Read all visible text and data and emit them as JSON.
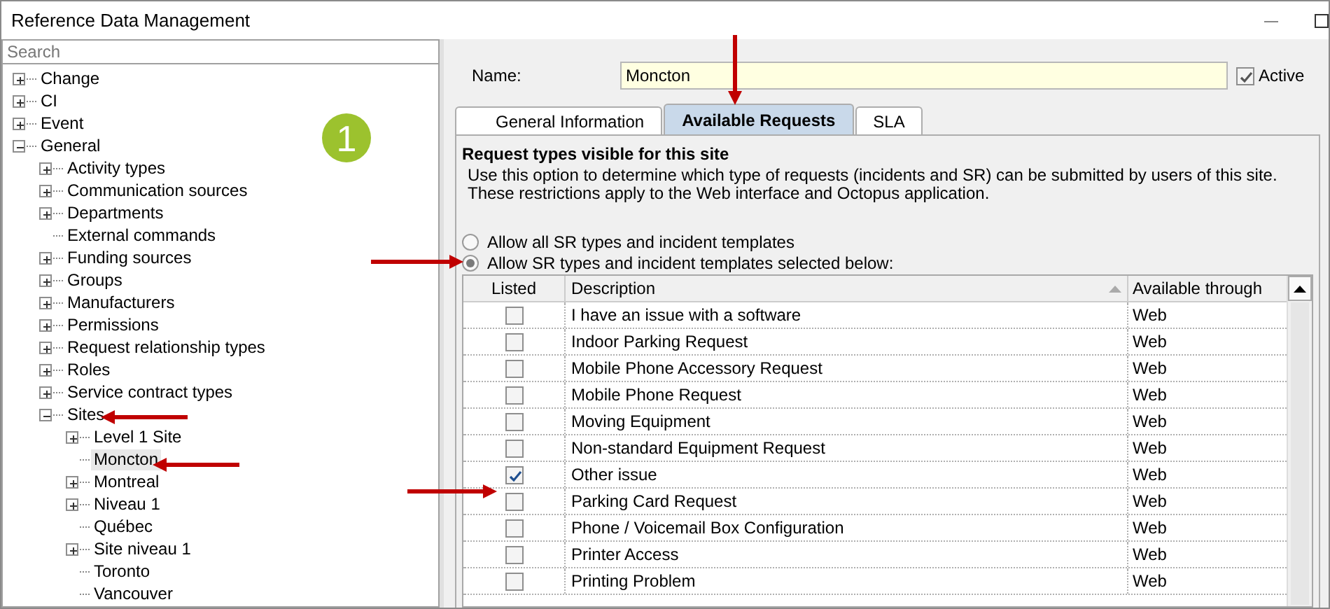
{
  "window": {
    "title": "Reference Data Management"
  },
  "search": {
    "placeholder": "Search"
  },
  "tree": [
    {
      "label": "Change",
      "expanded": false,
      "selected": false
    },
    {
      "label": "CI",
      "expanded": false,
      "selected": false
    },
    {
      "label": "Event",
      "expanded": false,
      "selected": false
    },
    {
      "label": "General",
      "expanded": true,
      "selected": false,
      "children": [
        {
          "label": "Activity types",
          "expanded": false,
          "selected": false
        },
        {
          "label": "Communication sources",
          "expanded": false,
          "selected": false
        },
        {
          "label": "Departments",
          "expanded": false,
          "selected": false
        },
        {
          "label": "External commands",
          "selected": false
        },
        {
          "label": "Funding sources",
          "expanded": false,
          "selected": false
        },
        {
          "label": "Groups",
          "expanded": false,
          "selected": false
        },
        {
          "label": "Manufacturers",
          "expanded": false,
          "selected": false
        },
        {
          "label": "Permissions",
          "expanded": false,
          "selected": false
        },
        {
          "label": "Request relationship types",
          "expanded": false,
          "selected": false
        },
        {
          "label": "Roles",
          "expanded": false,
          "selected": false
        },
        {
          "label": "Service contract types",
          "expanded": false,
          "selected": false
        },
        {
          "label": "Sites",
          "expanded": true,
          "selected": false,
          "children": [
            {
              "label": "Level 1 Site",
              "expanded": false,
              "selected": false
            },
            {
              "label": "Moncton",
              "selected": true
            },
            {
              "label": "Montreal",
              "expanded": false,
              "selected": false
            },
            {
              "label": "Niveau 1",
              "expanded": false,
              "selected": false
            },
            {
              "label": "Québec",
              "selected": false
            },
            {
              "label": "Site niveau 1",
              "expanded": false,
              "selected": false
            },
            {
              "label": "Toronto",
              "selected": false
            },
            {
              "label": "Vancouver",
              "selected": false
            }
          ]
        }
      ]
    }
  ],
  "callout": {
    "number": "1"
  },
  "name_field": {
    "label": "Name:",
    "value": "Moncton"
  },
  "active": {
    "label": "Active",
    "checked": true
  },
  "tabs": [
    {
      "label": "General Information",
      "selected": false
    },
    {
      "label": "Available Requests",
      "selected": true
    },
    {
      "label": "SLA",
      "selected": false
    }
  ],
  "section": {
    "title": "Request types visible for this site",
    "description": [
      "Use this option to determine which type of requests (incidents and SR) can be submitted by users of this site.",
      "These restrictions apply to the Web interface and Octopus application."
    ]
  },
  "options": [
    {
      "label": "Allow all SR types and incident templates",
      "selected": false
    },
    {
      "label": "Allow SR types and incident templates selected below:",
      "selected": true
    }
  ],
  "table": {
    "columns": [
      "Listed",
      "Description",
      "Available through"
    ],
    "rows": [
      {
        "listed": false,
        "description": "I have an issue with a software",
        "available": "Web"
      },
      {
        "listed": false,
        "description": "Indoor Parking Request",
        "available": "Web"
      },
      {
        "listed": false,
        "description": "Mobile Phone Accessory Request",
        "available": "Web"
      },
      {
        "listed": false,
        "description": "Mobile Phone Request",
        "available": "Web"
      },
      {
        "listed": false,
        "description": "Moving Equipment",
        "available": "Web"
      },
      {
        "listed": false,
        "description": "Non-standard Equipment Request",
        "available": "Web"
      },
      {
        "listed": true,
        "description": "Other issue",
        "available": "Web"
      },
      {
        "listed": false,
        "description": "Parking Card Request",
        "available": "Web"
      },
      {
        "listed": false,
        "description": "Phone / Voicemail Box Configuration",
        "available": "Web"
      },
      {
        "listed": false,
        "description": "Printer Access",
        "available": "Web"
      },
      {
        "listed": false,
        "description": "Printing Problem",
        "available": "Web"
      }
    ]
  }
}
